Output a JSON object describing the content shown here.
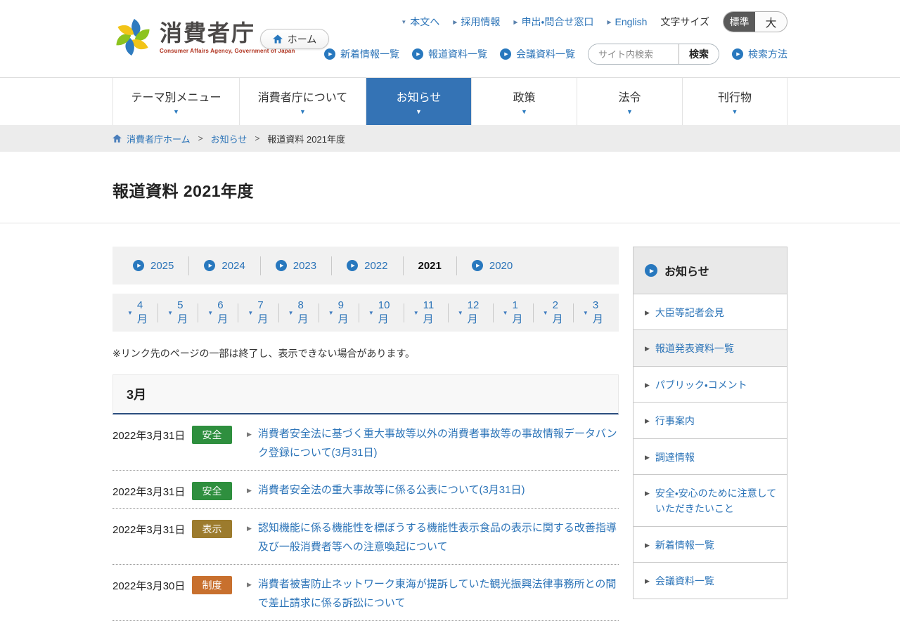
{
  "header": {
    "logo_title": "消費者庁",
    "logo_subtitle": "Consumer Affairs Agency, Government of Japan",
    "home_button": "ホーム",
    "utility": {
      "to_content": "本文へ",
      "recruit": "採用情報",
      "contact": "申出・問合せ窓口",
      "english": "English",
      "font_size_label": "文字サイズ",
      "size_standard": "標準",
      "size_large": "大"
    },
    "quick": {
      "new_info": "新着情報一覧",
      "press": "報道資料一覧",
      "meeting": "会議資料一覧",
      "search_placeholder": "サイト内検索",
      "search_button": "検索",
      "search_help": "検索方法"
    }
  },
  "nav": {
    "items": [
      {
        "label": "テーマ別メニュー",
        "active": false
      },
      {
        "label": "消費者庁について",
        "active": false
      },
      {
        "label": "お知らせ",
        "active": true
      },
      {
        "label": "政策",
        "active": false
      },
      {
        "label": "法令",
        "active": false
      },
      {
        "label": "刊行物",
        "active": false
      }
    ]
  },
  "breadcrumb": {
    "home": "消費者庁ホーム",
    "section": "お知らせ",
    "current": "報道資料 2021年度",
    "separator": ">"
  },
  "page_title": "報道資料 2021年度",
  "years": [
    {
      "label": "2025",
      "current": false
    },
    {
      "label": "2024",
      "current": false
    },
    {
      "label": "2023",
      "current": false
    },
    {
      "label": "2022",
      "current": false
    },
    {
      "label": "2021",
      "current": true
    },
    {
      "label": "2020",
      "current": false
    }
  ],
  "months": [
    "4月",
    "5月",
    "6月",
    "7月",
    "8月",
    "9月",
    "10月",
    "11月",
    "12月",
    "1月",
    "2月",
    "3月"
  ],
  "notice": "※リンク先のページの一部は終了し、表示できない場合があります。",
  "section_heading": "3月",
  "news": [
    {
      "date": "2022年3月31日",
      "category": "安全",
      "category_color": "#2e8f3e",
      "title": "消費者安全法に基づく重大事故等以外の消費者事故等の事故情報データバンク登録について(3月31日)"
    },
    {
      "date": "2022年3月31日",
      "category": "安全",
      "category_color": "#2e8f3e",
      "title": "消費者安全法の重大事故等に係る公表について(3月31日)"
    },
    {
      "date": "2022年3月31日",
      "category": "表示",
      "category_color": "#9c7b2d",
      "title": "認知機能に係る機能性を標ぼうする機能性表示食品の表示に関する改善指導及び一般消費者等への注意喚起について"
    },
    {
      "date": "2022年3月30日",
      "category": "制度",
      "category_color": "#c8702e",
      "title": "消費者被害防止ネットワーク東海が提訴していた観光振興法律事務所との間で差止請求に係る訴訟について"
    }
  ],
  "sidebar": {
    "heading": "お知らせ",
    "items": [
      {
        "label": "大臣等記者会見",
        "current": false
      },
      {
        "label": "報道発表資料一覧",
        "current": true
      },
      {
        "label": "パブリック・コメント",
        "current": false
      },
      {
        "label": "行事案内",
        "current": false
      },
      {
        "label": "調達情報",
        "current": false
      },
      {
        "label": "安全・安心のために注意していただきたいこと",
        "current": false
      },
      {
        "label": "新着情報一覧",
        "current": false
      },
      {
        "label": "会議資料一覧",
        "current": false
      }
    ]
  },
  "colors": {
    "link_blue": "#2c74b8",
    "nav_active_blue": "#3473b5",
    "section_accent_navy": "#2b4d7e",
    "badge_safety_green": "#2e8f3e",
    "badge_labeling_brown": "#9c7b2d",
    "badge_system_orange": "#c8702e"
  },
  "icons": {
    "home": "home-icon",
    "circle_arrow": "circle-arrow-icon",
    "caret_down": "caret-down-icon",
    "caret_right": "caret-right-icon"
  }
}
